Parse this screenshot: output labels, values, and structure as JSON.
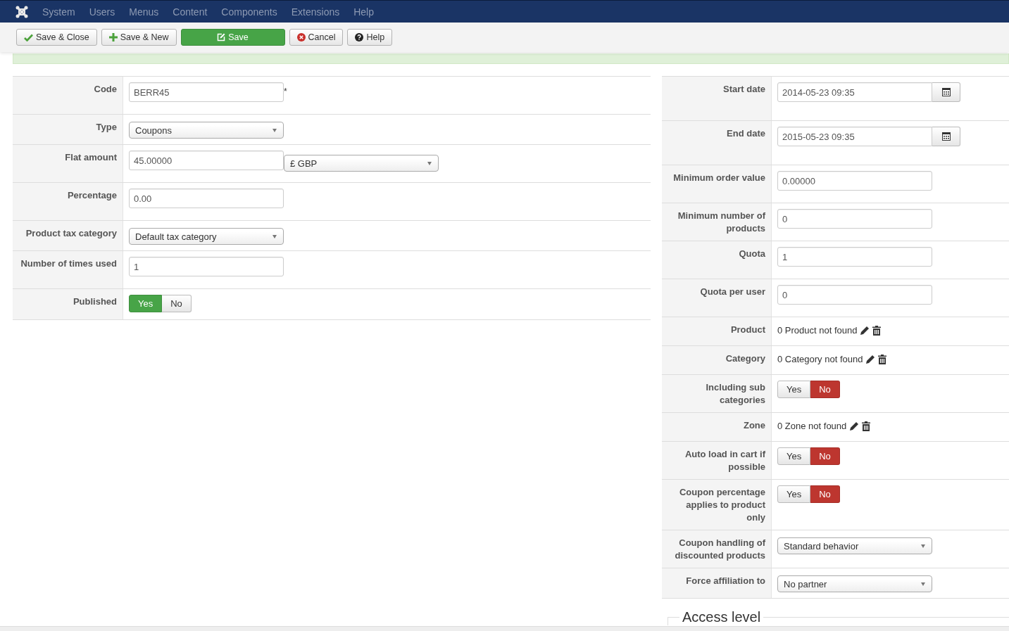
{
  "menu": [
    "System",
    "Users",
    "Menus",
    "Content",
    "Components",
    "Extensions",
    "Help"
  ],
  "toolbar": [
    {
      "label": "Save & Close",
      "kind": "check"
    },
    {
      "label": "Save & New",
      "kind": "plus"
    },
    {
      "label": "Save",
      "kind": "primary"
    },
    {
      "label": "Cancel",
      "kind": "cancel"
    },
    {
      "label": "Help",
      "kind": "help"
    }
  ],
  "left_fields": [
    {
      "label": "Code",
      "kind": "text",
      "value": "BERR45",
      "marker": "*"
    },
    {
      "label": "Type",
      "kind": "select",
      "value": "Coupons"
    },
    {
      "label": "Flat amount",
      "kind": "amount",
      "value": "45.00000",
      "currency": "£ GBP"
    },
    {
      "label": "Percentage",
      "kind": "text",
      "value": "0.00"
    },
    {
      "label": "Product tax category",
      "kind": "select",
      "value": "Default tax category"
    },
    {
      "label": "Number of times used",
      "kind": "text",
      "value": "1"
    },
    {
      "label": "Published",
      "kind": "toggle",
      "options": [
        {
          "label": "Yes",
          "kind": "yes",
          "selected": true
        },
        {
          "label": "No",
          "kind": "no",
          "selected": false
        }
      ]
    }
  ],
  "right_fields": [
    {
      "label": "Start date",
      "kind": "date",
      "value": "2014-05-23 09:35"
    },
    {
      "label": "End date",
      "kind": "date",
      "value": "2015-05-23 09:35"
    },
    {
      "label": "Minimum order value",
      "kind": "text",
      "value": "0.00000"
    },
    {
      "label": "Minimum number of products",
      "kind": "text",
      "value": "0"
    },
    {
      "label": "Quota",
      "kind": "text",
      "value": "1"
    },
    {
      "label": "Quota per user",
      "kind": "text",
      "value": "0"
    },
    {
      "label": "Product",
      "kind": "lookup",
      "value": "0 Product not found"
    },
    {
      "label": "Category",
      "kind": "lookup",
      "value": "0 Category not found"
    },
    {
      "label": "Including sub categories",
      "kind": "toggle",
      "options": [
        {
          "label": "Yes",
          "kind": "yes",
          "selected": false
        },
        {
          "label": "No",
          "kind": "no",
          "selected": true
        }
      ]
    },
    {
      "label": "Zone",
      "kind": "lookup",
      "value": "0 Zone not found"
    },
    {
      "label": "Auto load in cart if possible",
      "kind": "toggle",
      "options": [
        {
          "label": "Yes",
          "kind": "yes",
          "selected": false
        },
        {
          "label": "No",
          "kind": "no",
          "selected": true
        }
      ]
    },
    {
      "label": "Coupon percentage applies to product only",
      "kind": "toggle",
      "options": [
        {
          "label": "Yes",
          "kind": "yes",
          "selected": false
        },
        {
          "label": "No",
          "kind": "no",
          "selected": true
        }
      ]
    },
    {
      "label": "Coupon handling of discounted products",
      "kind": "select",
      "value": "Standard behavior"
    },
    {
      "label": "Force affiliation to",
      "kind": "select",
      "value": "No partner"
    }
  ],
  "access_level": {
    "legend": "Access level"
  }
}
